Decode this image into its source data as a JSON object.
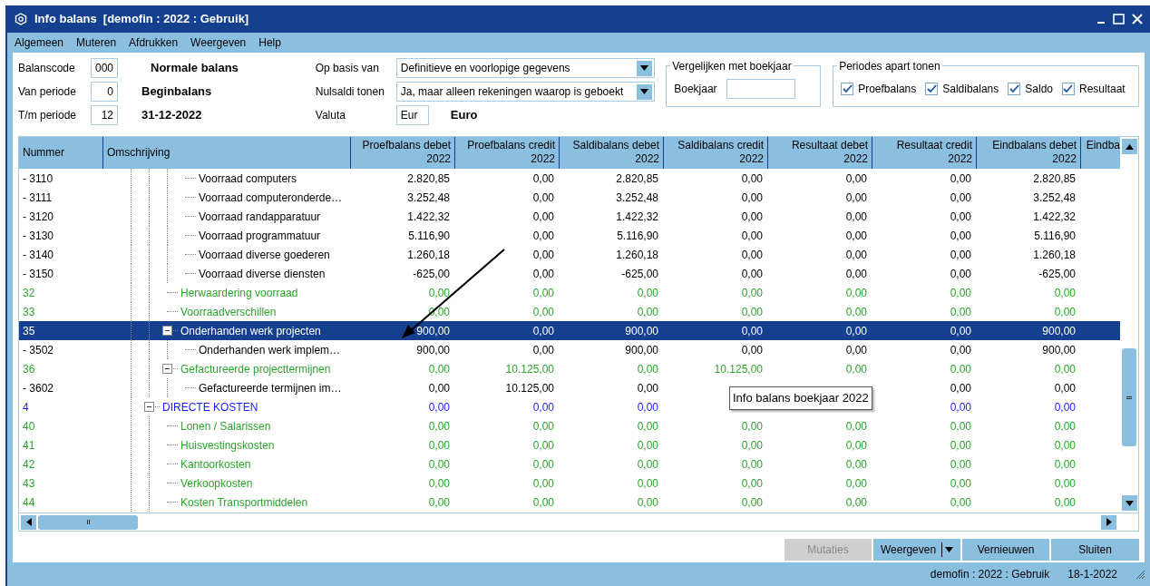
{
  "window": {
    "title": "Info balans  [demofin : 2022 : Gebruik]"
  },
  "menu": [
    "Algemeen",
    "Muteren",
    "Afdrukken",
    "Weergeven",
    "Help"
  ],
  "form": {
    "fields": [
      {
        "label": "Balanscode",
        "value": "000",
        "description": "Normale balans"
      },
      {
        "label": "Van periode",
        "value": "0",
        "description": "Beginbalans"
      },
      {
        "label": "T/m periode",
        "value": "12",
        "description": "31-12-2022"
      }
    ],
    "op_basis_van": {
      "label": "Op basis van",
      "value": "Definitieve en voorlopige gegevens"
    },
    "nulsaldi_tonen": {
      "label": "Nulsaldi tonen",
      "value": "Ja, maar alleen rekeningen waarop is geboekt"
    },
    "valuta": {
      "label": "Valuta",
      "value": "Eur",
      "description": "Euro"
    },
    "vergelijken": {
      "title": "Vergelijken met boekjaar",
      "label": "Boekjaar"
    },
    "periodes": {
      "title": "Periodes apart tonen",
      "options": [
        {
          "label": "Proefbalans",
          "checked": true
        },
        {
          "label": "Saldibalans",
          "checked": true
        },
        {
          "label": "Saldo",
          "checked": true
        },
        {
          "label": "Resultaat",
          "checked": true
        }
      ]
    }
  },
  "grid": {
    "columns": [
      "Nummer",
      "Omschrijving",
      "Proefbalans debet\n2022",
      "Proefbalans credit\n2022",
      "Saldibalans debet\n2022",
      "Saldibalans credit\n2022",
      "Resultaat debet\n2022",
      "Resultaat credit\n2022",
      "Eindbalans debet\n2022",
      "Eindba"
    ],
    "rows": [
      {
        "children": [
          {
            "children": [
              {
                "nummer": "- 3110",
                "omschrijving": "Voorraad computers",
                "kind": "account",
                "selected": false,
                "values": [
                  "2.820,85",
                  "0,00",
                  "2.820,85",
                  "0,00",
                  "0,00",
                  "0,00",
                  "2.820,85"
                ]
              },
              {
                "nummer": "- 3111",
                "omschrijving": "Voorraad computeronderde…",
                "kind": "account",
                "selected": false,
                "values": [
                  "3.252,48",
                  "0,00",
                  "3.252,48",
                  "0,00",
                  "0,00",
                  "0,00",
                  "3.252,48"
                ]
              },
              {
                "nummer": "- 3120",
                "omschrijving": "Voorraad randapparatuur",
                "kind": "account",
                "selected": false,
                "values": [
                  "1.422,32",
                  "0,00",
                  "1.422,32",
                  "0,00",
                  "0,00",
                  "0,00",
                  "1.422,32"
                ]
              },
              {
                "nummer": "- 3130",
                "omschrijving": "Voorraad programmatuur",
                "kind": "account",
                "selected": false,
                "values": [
                  "5.116,90",
                  "0,00",
                  "5.116,90",
                  "0,00",
                  "0,00",
                  "0,00",
                  "5.116,90"
                ]
              },
              {
                "nummer": "- 3140",
                "omschrijving": "Voorraad diverse goederen",
                "kind": "account",
                "selected": false,
                "values": [
                  "1.260,18",
                  "0,00",
                  "1.260,18",
                  "0,00",
                  "0,00",
                  "0,00",
                  "1.260,18"
                ]
              },
              {
                "nummer": "- 3150",
                "omschrijving": "Voorraad diverse diensten",
                "kind": "account",
                "selected": false,
                "values": [
                  "-625,00",
                  "0,00",
                  "-625,00",
                  "0,00",
                  "0,00",
                  "0,00",
                  "-625,00"
                ]
              }
            ]
          },
          {
            "nummer": "32",
            "omschrijving": "Herwaardering voorraad",
            "kind": "group",
            "selected": false,
            "values": [
              "0,00",
              "0,00",
              "0,00",
              "0,00",
              "0,00",
              "0,00",
              "0,00"
            ]
          },
          {
            "nummer": "33",
            "omschrijving": "Voorraadverschillen",
            "kind": "group",
            "selected": false,
            "values": [
              "0,00",
              "0,00",
              "0,00",
              "0,00",
              "0,00",
              "0,00",
              "0,00"
            ]
          },
          {
            "nummer": "35",
            "omschrijving": "Onderhanden werk projecten",
            "kind": "group",
            "selected": true,
            "expanded": true,
            "values": [
              "900,00",
              "0,00",
              "900,00",
              "0,00",
              "0,00",
              "0,00",
              "900,00"
            ],
            "children": [
              {
                "nummer": "- 3502",
                "omschrijving": "Onderhanden werk implem…",
                "kind": "account",
                "selected": false,
                "values": [
                  "900,00",
                  "0,00",
                  "900,00",
                  "0,00",
                  "0,00",
                  "0,00",
                  "900,00"
                ]
              }
            ]
          },
          {
            "nummer": "36",
            "omschrijving": "Gefactureerde projecttermijnen",
            "kind": "group",
            "selected": false,
            "expanded": true,
            "values": [
              "0,00",
              "10.125,00",
              "0,00",
              "10.125,00",
              "0,00",
              "0,00",
              "0,00"
            ],
            "children": [
              {
                "nummer": "- 3602",
                "omschrijving": "Gefactureerde termijnen im…",
                "kind": "account",
                "selected": false,
                "values": [
                  "0,00",
                  "10.125,00",
                  "0,00"
                ],
                "values_after_tooltip": [
                  "0,00",
                  "0,00"
                ]
              }
            ]
          }
        ]
      },
      {
        "nummer": "4",
        "omschrijving": "DIRECTE KOSTEN",
        "kind": "category",
        "selected": false,
        "expanded": true,
        "values": [
          "0,00",
          "0,00",
          "0,00"
        ],
        "values_after_tooltip": [
          "0,00",
          "0,00"
        ],
        "children": [
          {
            "nummer": "40",
            "omschrijving": "Lonen / Salarissen",
            "kind": "group",
            "selected": false,
            "values": [
              "0,00",
              "0,00",
              "0,00",
              "0,00",
              "0,00",
              "0,00",
              "0,00"
            ]
          },
          {
            "nummer": "41",
            "omschrijving": "Huisvestingskosten",
            "kind": "group",
            "selected": false,
            "values": [
              "0,00",
              "0,00",
              "0,00",
              "0,00",
              "0,00",
              "0,00",
              "0,00"
            ]
          },
          {
            "nummer": "42",
            "omschrijving": "Kantoorkosten",
            "kind": "group",
            "selected": false,
            "values": [
              "0,00",
              "0,00",
              "0,00",
              "0,00",
              "0,00",
              "0,00",
              "0,00"
            ]
          },
          {
            "nummer": "43",
            "omschrijving": "Verkoopkosten",
            "kind": "group",
            "selected": false,
            "values": [
              "0,00",
              "0,00",
              "0,00",
              "0,00",
              "0,00",
              "0,00",
              "0,00"
            ]
          },
          {
            "nummer": "44",
            "omschrijving": "Kosten Transportmiddelen",
            "kind": "group",
            "selected": false,
            "values": [
              "0,00",
              "0,00",
              "0,00",
              "0,00",
              "0,00",
              "0,00",
              "0,00"
            ]
          }
        ]
      }
    ]
  },
  "tooltip": "Info balans boekjaar 2022",
  "buttons": [
    {
      "label": "Mutaties",
      "kind": "plain",
      "disabled": true
    },
    {
      "label": "Weergeven",
      "kind": "split",
      "disabled": false
    },
    {
      "label": "Vernieuwen",
      "kind": "plain",
      "disabled": false
    },
    {
      "label": "Sluiten",
      "kind": "plain",
      "disabled": false
    }
  ],
  "status_bar": {
    "context": "demofin : 2022 : Gebruik",
    "date": "18-1-2022"
  }
}
